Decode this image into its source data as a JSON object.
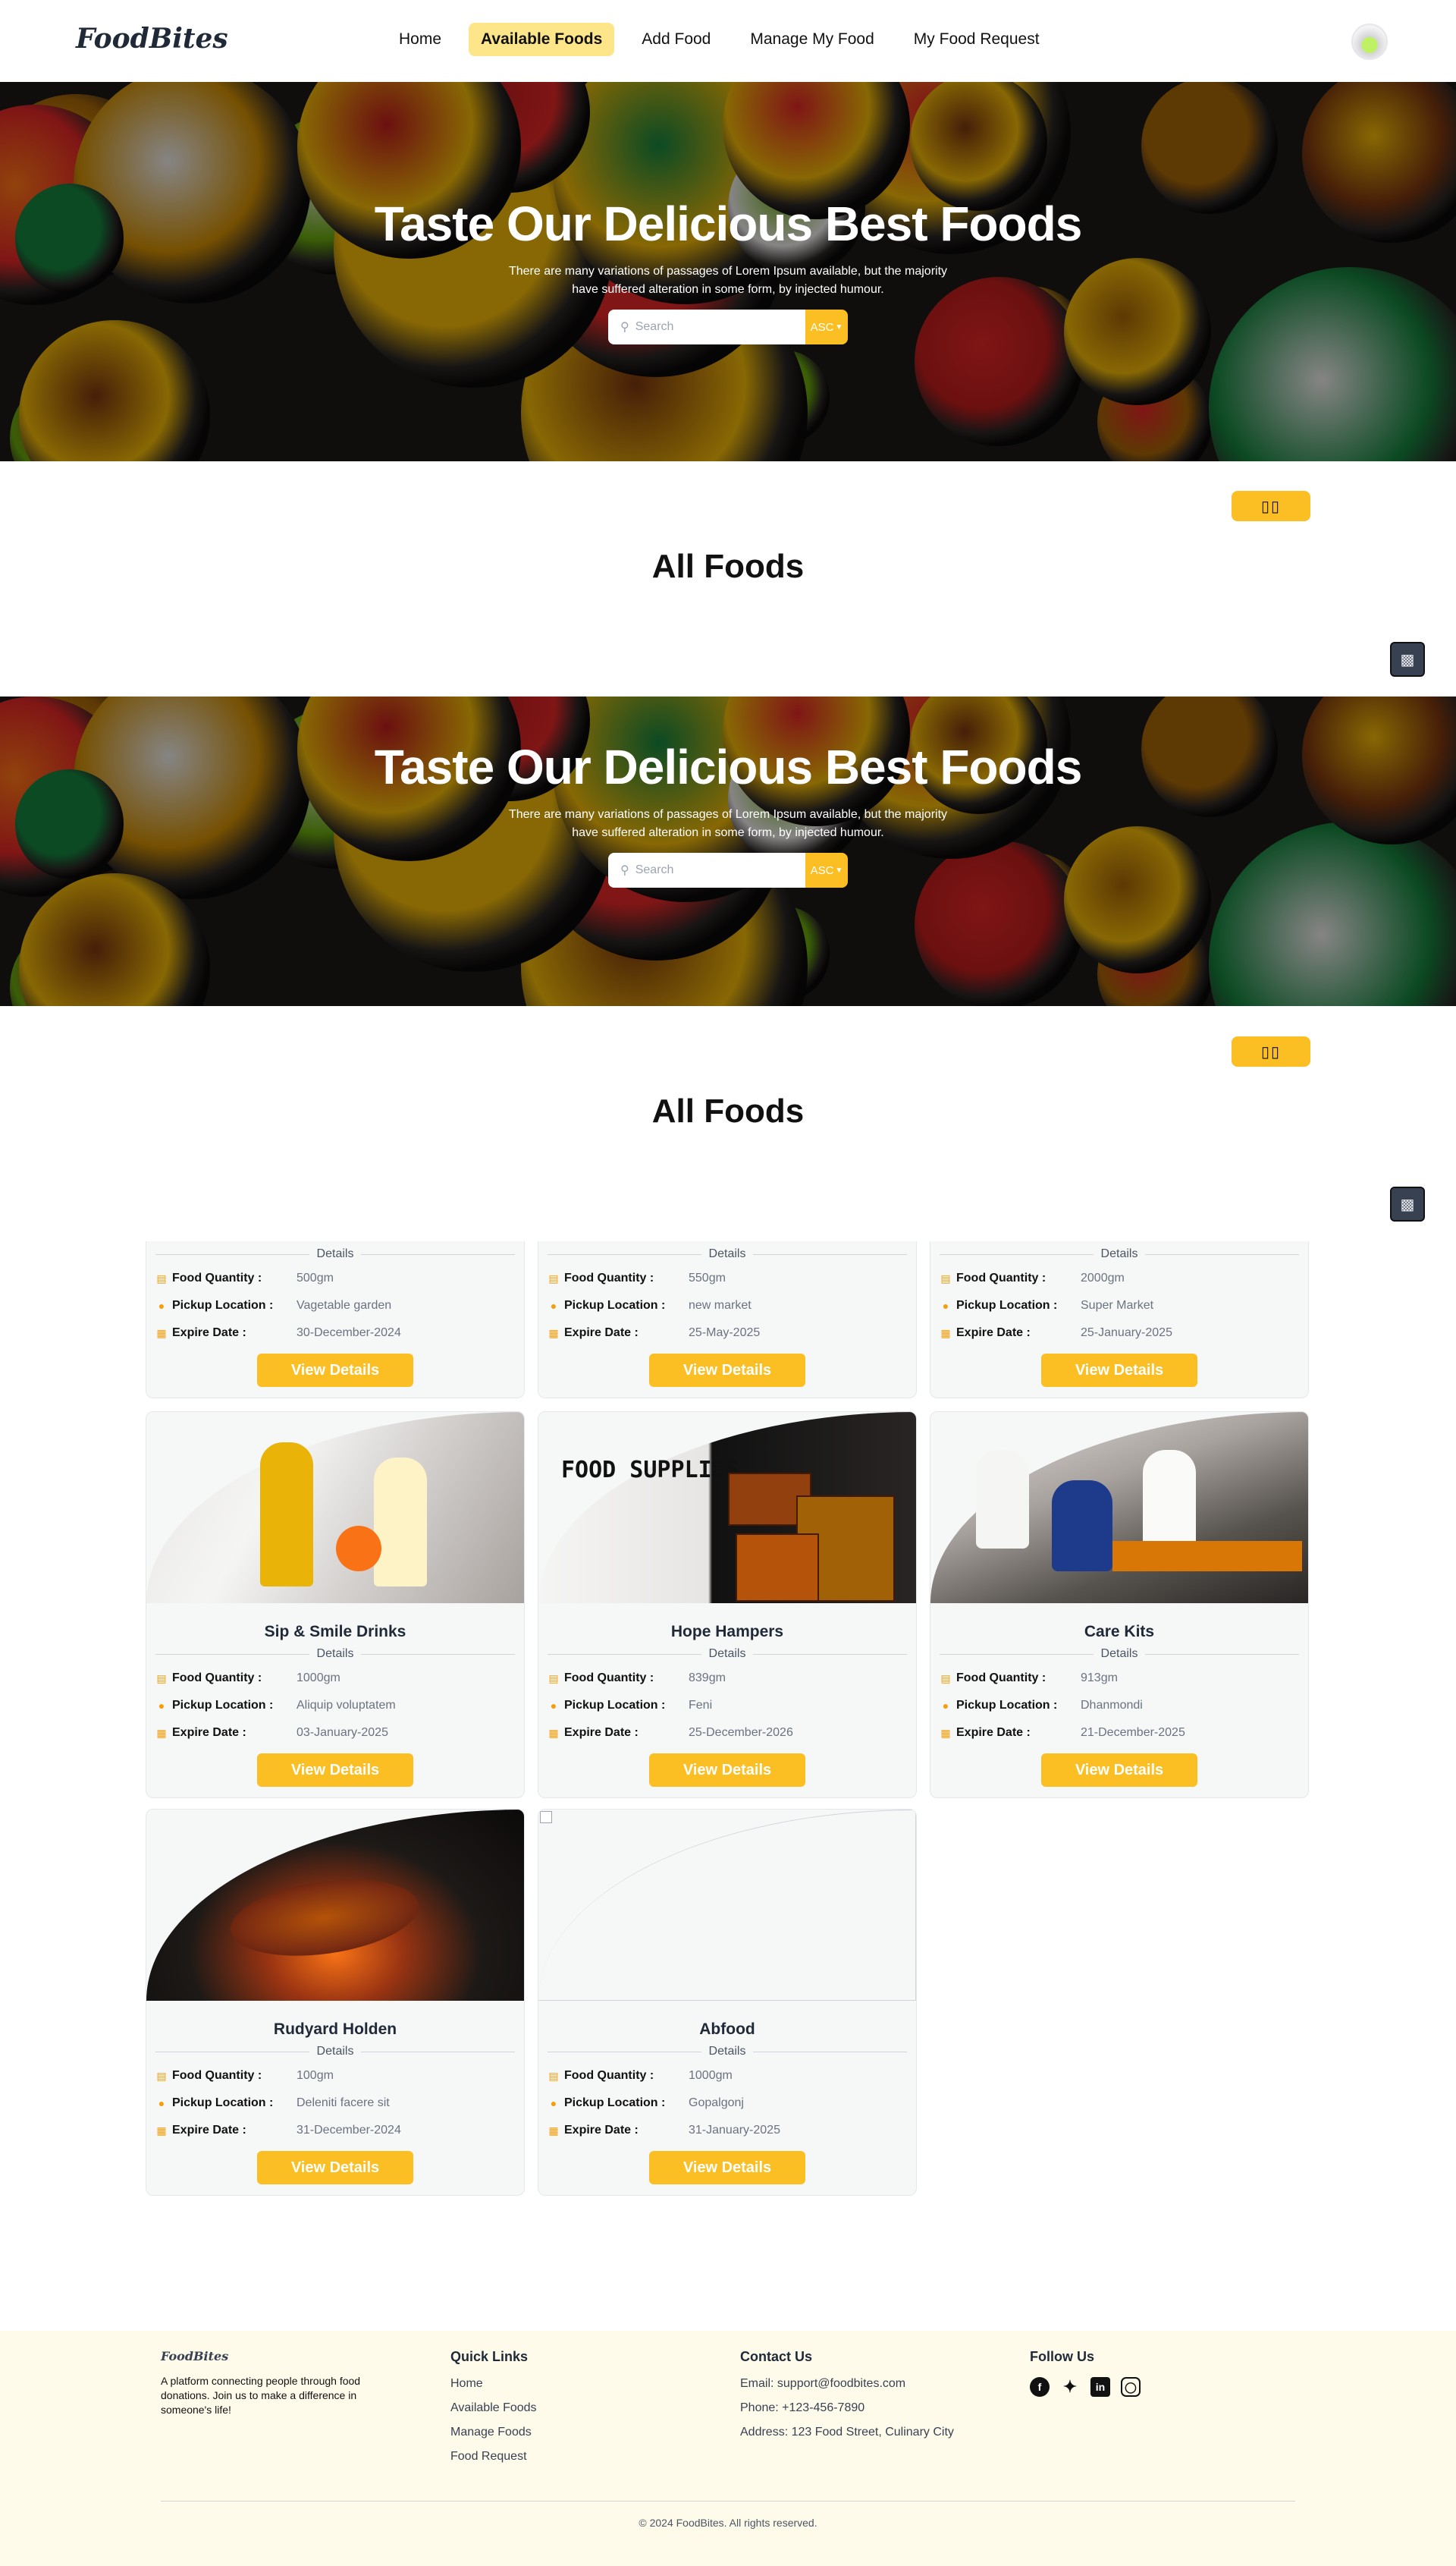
{
  "brand": "FoodBites",
  "nav": {
    "items": [
      "Home",
      "Available Foods",
      "Add Food",
      "Manage My Food",
      "My Food Request"
    ],
    "active": 1
  },
  "hero": {
    "title": "Taste Our Delicious Best Foods",
    "text": "There are many variations of passages of Lorem Ipsum available, but the majority have suffered alteration in some form, by injected humour.",
    "search_placeholder": "Search",
    "sort": "ASC"
  },
  "section_title": "All Foods",
  "toggle_label": "▯▯",
  "labels": {
    "details": "Details",
    "qty": "Food Quantity :",
    "loc": "Pickup Location :",
    "exp": "Expire Date :",
    "btn": "View Details"
  },
  "partial_cards": [
    {
      "qty": "500gm",
      "loc": "Vagetable garden",
      "exp": "30-December-2024"
    },
    {
      "qty": "550gm",
      "loc": "new market",
      "exp": "25-May-2025"
    },
    {
      "qty": "2000gm",
      "loc": "Super Market",
      "exp": "25-January-2025"
    }
  ],
  "cards": [
    {
      "name": "Sip & Smile Drinks",
      "qty": "1000gm",
      "loc": "Aliquip voluptatem",
      "exp": "03-January-2025",
      "img": "volunteers-handing-food"
    },
    {
      "name": "Hope Hampers",
      "qty": "839gm",
      "loc": "Feni",
      "exp": "25-December-2026",
      "img": "food-supplies-boxes",
      "img_text": "FOOD SUPPLIES"
    },
    {
      "name": "Care Kits",
      "qty": "913gm",
      "loc": "Dhanmondi",
      "exp": "21-December-2025",
      "img": "food-drive-crowd"
    },
    {
      "name": "Rudyard Holden",
      "qty": "100gm",
      "loc": "Deleniti facere sit",
      "exp": "31-December-2024",
      "img": "grilled-steak"
    },
    {
      "name": "Abfood",
      "qty": "1000gm",
      "loc": "Gopalgonj",
      "exp": "31-January-2025",
      "img": "broken-image"
    }
  ],
  "footer": {
    "tagline": "A platform connecting people through food donations. Join us to make a difference in someone's life!",
    "quick_title": "Quick Links",
    "quick": [
      "Home",
      "Available Foods",
      "Manage Foods",
      "Food Request"
    ],
    "contact_title": "Contact Us",
    "contact": [
      "Email: support@foodbites.com",
      "Phone: +123-456-7890",
      "Address: 123 Food Street, Culinary City"
    ],
    "follow_title": "Follow Us",
    "social": [
      "facebook-icon",
      "twitter-icon",
      "linkedin-icon",
      "instagram-icon"
    ],
    "copyright": "© 2024 FoodBites. All rights reserved."
  },
  "colors": {
    "accent": "#fbbf24",
    "accent_light": "#fde68a",
    "footer_bg": "#fffbeb"
  }
}
